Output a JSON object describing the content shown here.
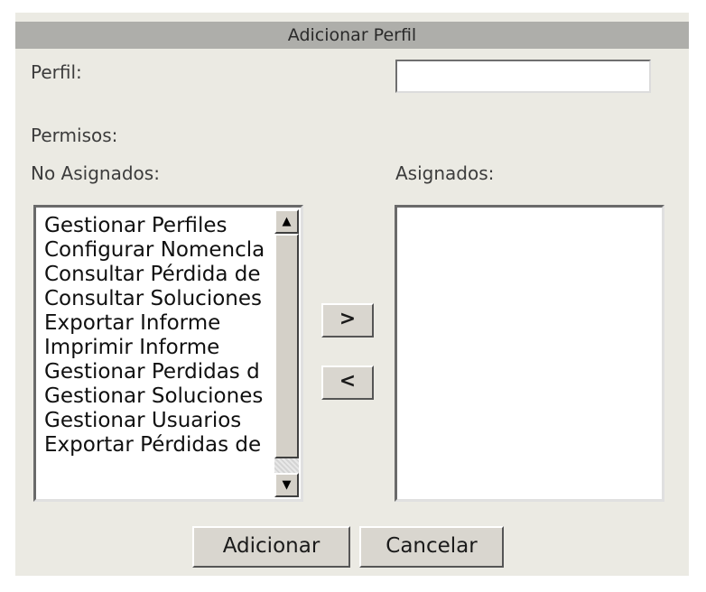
{
  "dialog": {
    "title": "Adicionar Perfil",
    "perfil_label": "Perfil:",
    "perfil_value": "",
    "permisos_label": "Permisos:",
    "no_asignados_label": "No Asignados:",
    "asignados_label": "Asignados:",
    "no_asignados_items": [
      "Gestionar Perfiles",
      "Configurar Nomencla",
      "Consultar Pérdida de",
      "Consultar Soluciones",
      "Exportar Informe",
      "Imprimir Informe",
      "Gestionar Perdidas d",
      "Gestionar Soluciones",
      "Gestionar Usuarios",
      "Exportar Pérdidas de"
    ],
    "asignados_items": [],
    "move_right_label": ">",
    "move_left_label": "<",
    "add_label": "Adicionar",
    "cancel_label": "Cancelar"
  },
  "colors": {
    "header_bg": "#aeaeaa",
    "panel_bg": "#ebeae3",
    "button_face": "#d9d6cf"
  },
  "icons": {
    "scroll_up": "up-arrow-icon",
    "scroll_down": "down-arrow-icon"
  }
}
